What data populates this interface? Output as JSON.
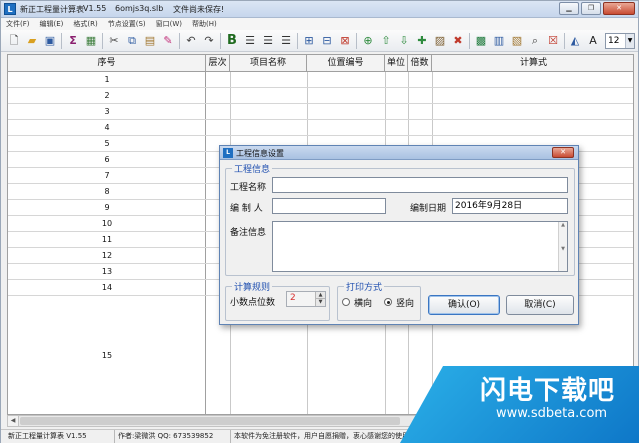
{
  "app": {
    "title": "新正工程量计算表",
    "version": "V1.55",
    "file_name": "6omjs3q.slb",
    "save_status": "文件尚未保存!"
  },
  "window_controls": [
    "minimize-icon",
    "restore-icon",
    "close-icon"
  ],
  "menu": [
    "文件(F)",
    "编辑(E)",
    "格式(R)",
    "节点设置(S)",
    "窗口(W)",
    "帮助(H)"
  ],
  "toolbar": {
    "font_size": "12",
    "icons": [
      "new-file-icon",
      "open-folder-icon",
      "save-icon",
      "sum-icon",
      "calculator-icon",
      "cut-icon",
      "copy-icon",
      "paste-icon",
      "eraser-icon",
      "undo-icon",
      "redo-icon",
      "bold-icon",
      "align-left-icon",
      "align-center-icon",
      "align-right-icon",
      "insert-row-icon",
      "insert-column-icon",
      "delete-cell-icon",
      "add-node-icon",
      "move-up-icon",
      "move-down-icon",
      "add-item-icon",
      "picture-icon",
      "delete-item-icon",
      "excel-icon",
      "table-icon",
      "copy-table-icon",
      "search-icon",
      "close-doc-icon",
      "fill-color-icon",
      "font-color-icon"
    ]
  },
  "grid": {
    "columns": [
      "序号",
      "层次",
      "项目名称",
      "位置编号",
      "单位",
      "倍数",
      "计算式"
    ],
    "rows": [
      "1",
      "2",
      "3",
      "4",
      "5",
      "6",
      "7",
      "8",
      "9",
      "10",
      "11",
      "12",
      "13",
      "14",
      "15"
    ]
  },
  "dialog": {
    "title": "工程信息设置",
    "project_group": "工程信息",
    "project_name_label": "工程名称",
    "project_name_value": "",
    "editor_label": "编 制 人",
    "editor_value": "",
    "date_label": "编制日期",
    "date_value": "2016年9月28日",
    "notes_label": "备注信息",
    "notes_value": "",
    "calc_group": "计算规则",
    "decimals_label": "小数点位数",
    "decimals_value": "2",
    "print_group": "打印方式",
    "orientation_landscape": "横向",
    "orientation_portrait": "竖向",
    "selected_orientation": "竖向",
    "ok_button": "确认(O)",
    "cancel_button": "取消(C)"
  },
  "statusbar": [
    "新正工程量计算表  V1.55",
    "作者:梁微洪   QQ: 673539852",
    "本软件为免注册软件，用户自愿捐赠，衷心感谢您的使用"
  ],
  "watermark": {
    "title": "闪电下载吧",
    "url": "www.sdbeta.com"
  },
  "colors": {
    "group_title": "#1f4fb0",
    "decimals_value": "#d73030",
    "watermark": "#0e77c8"
  }
}
